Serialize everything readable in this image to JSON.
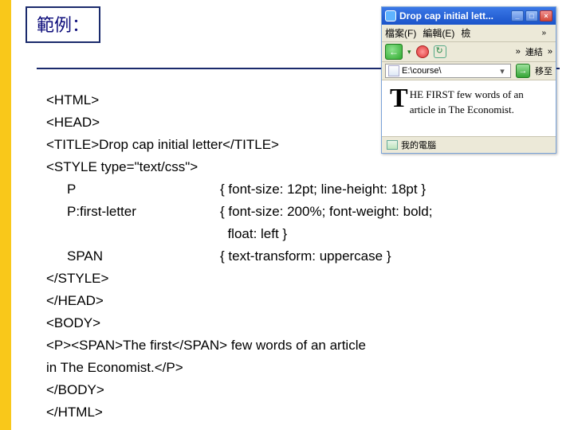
{
  "slide": {
    "label": "範例："
  },
  "preview": {
    "title": "Drop cap initial lett...",
    "menu": {
      "file": "檔案(F)",
      "edit": "編輯(E)",
      "view": "檢",
      "chev": "»",
      "ext": ""
    },
    "links_chev": "»",
    "links_label": "連結",
    "address": "E:\\course\\",
    "go_label": "移至",
    "content": {
      "drop": "T",
      "caps": "HE FIRST",
      "rest": " few words of an article in The Economist."
    },
    "status": "我的電腦"
  },
  "code": {
    "l1": "<HTML>",
    "l2": "<HEAD>",
    "l3": "<TITLE>Drop cap initial letter</TITLE>",
    "l4": "<STYLE type=\"text/css\">",
    "sel_p": "P",
    "decl_p": "{ font-size: 12pt; line-height: 18pt }",
    "sel_pfl": "P:first-letter",
    "decl_pfl1": "{ font-size: 200%; font-weight: bold;",
    "decl_pfl2": "  float: left }",
    "sel_span": "SPAN",
    "decl_span": "{ text-transform: uppercase }",
    "l9": "</STYLE>",
    "l10": "</HEAD>",
    "l11": "<BODY>",
    "l12": "<P><SPAN>The first</SPAN> few words of an article",
    "l13": "in The Economist.</P>",
    "l14": "</BODY>",
    "l15": "</HTML>"
  }
}
